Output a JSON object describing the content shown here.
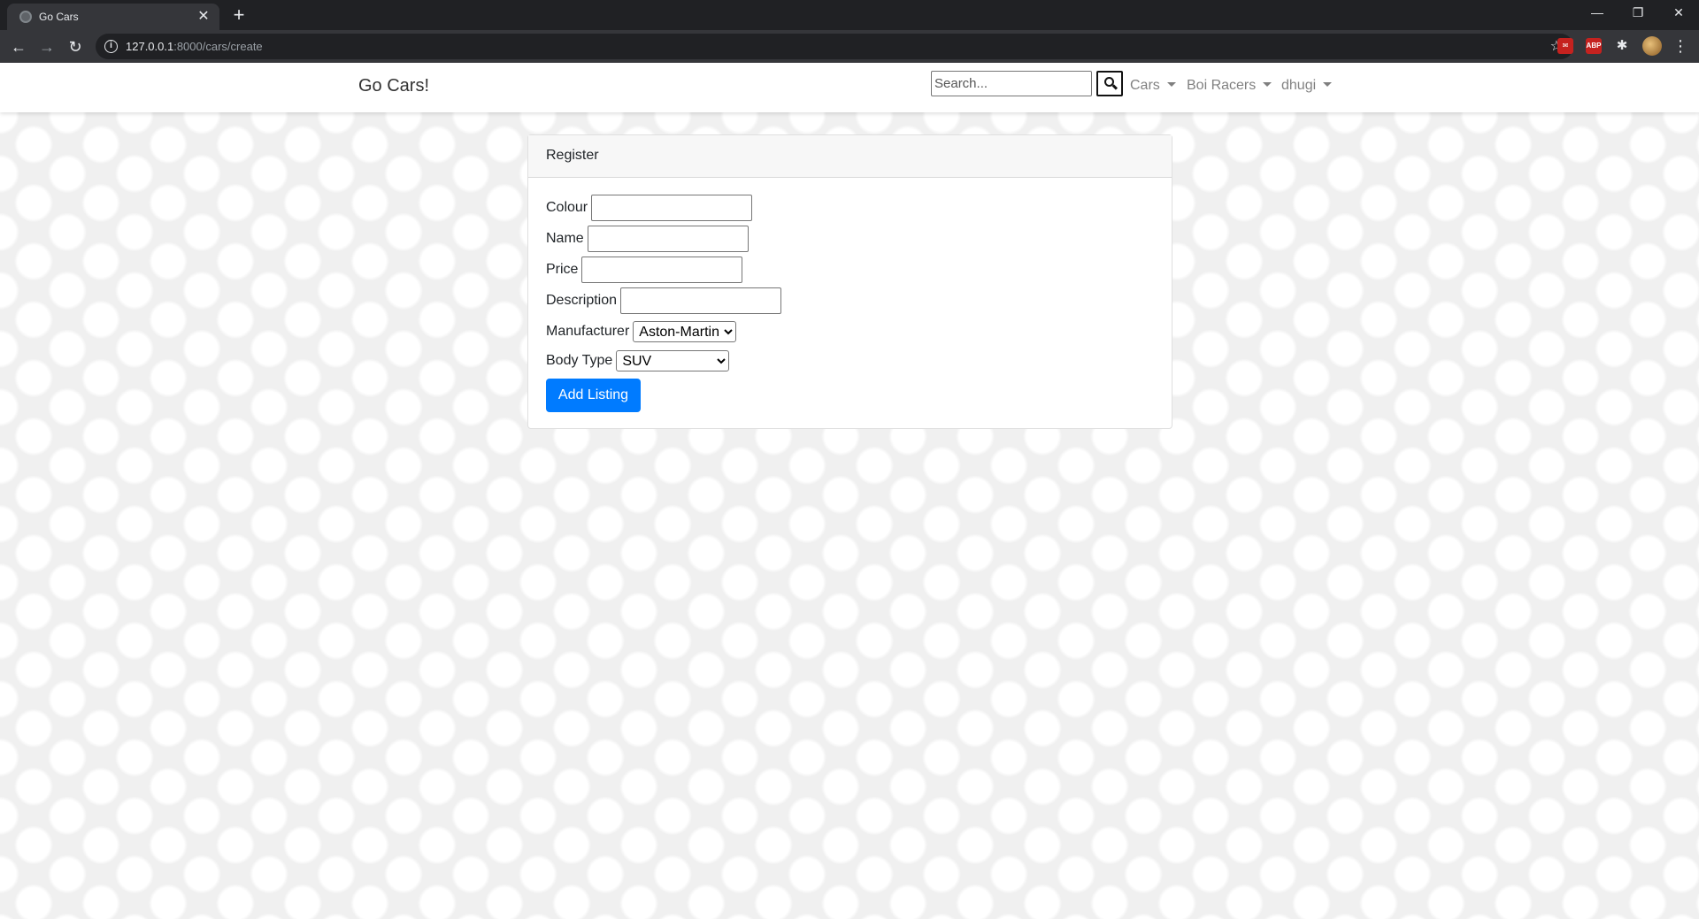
{
  "browser": {
    "tab_title": "Go Cars",
    "url_host": "127.0.0.1",
    "url_path": ":8000/cars/create",
    "ext_abp_label": "ABP"
  },
  "navbar": {
    "brand": "Go Cars!",
    "search_placeholder": "Search...",
    "menus": [
      "Cars",
      "Boi Racers",
      "dhugi"
    ]
  },
  "card": {
    "header": "Register",
    "fields": {
      "colour": "Colour",
      "name": "Name",
      "price": "Price",
      "description": "Description",
      "manufacturer": "Manufacturer",
      "body_type": "Body Type"
    },
    "manufacturer_selected": "Aston-Martin",
    "body_type_selected": "SUV",
    "submit_label": "Add Listing"
  },
  "colors": {
    "primary": "#007bff",
    "chrome_dark": "#202124",
    "chrome_toolbar": "#35363a"
  }
}
